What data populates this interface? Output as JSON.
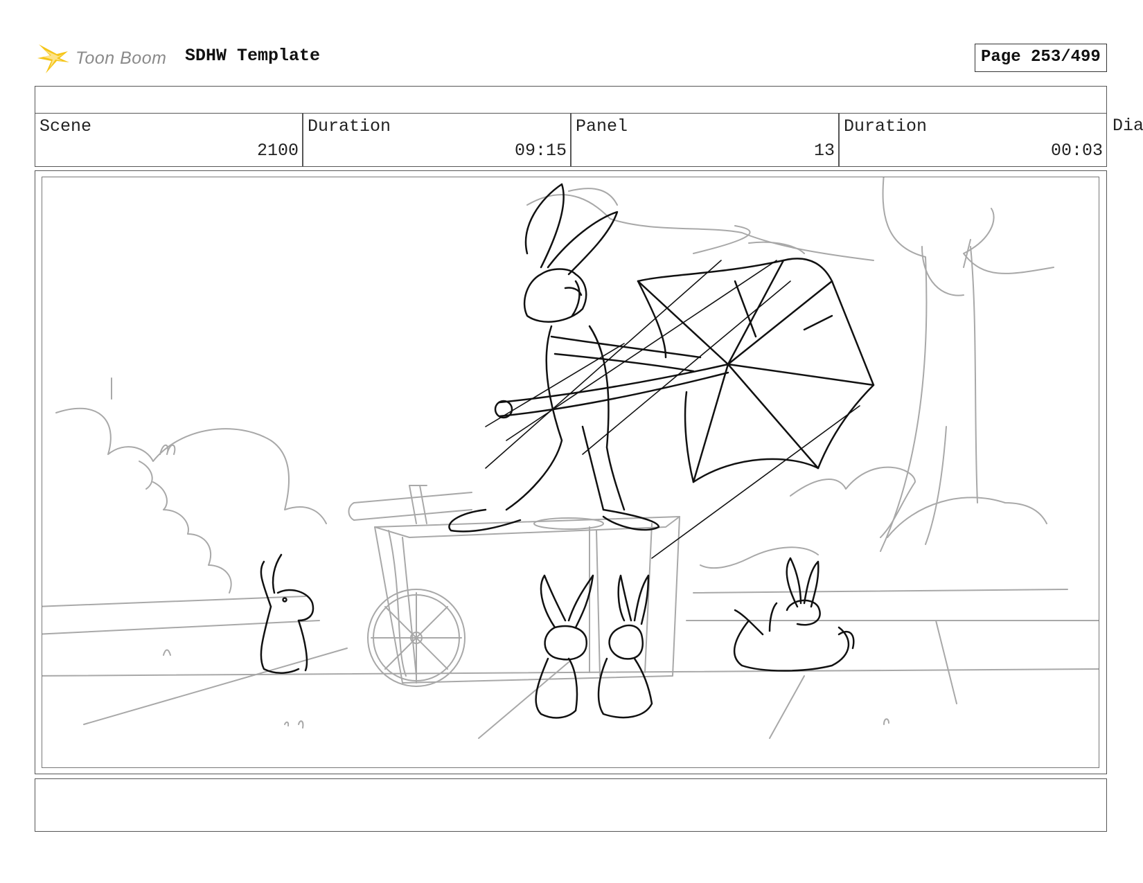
{
  "header": {
    "logo_text": "Toon Boom",
    "title": "SDHW Template",
    "page_label": "Page 253/499"
  },
  "info": {
    "scene": {
      "label": "Scene",
      "value": "2100"
    },
    "scene_duration": {
      "label": "Duration",
      "value": "09:15"
    },
    "panel": {
      "label": "Panel",
      "value": "13"
    },
    "panel_duration": {
      "label": "Duration",
      "value": "00:03"
    },
    "dialog_label_cut": "Dia"
  },
  "colors": {
    "logo_yellow": "#f5c518",
    "border": "#555555",
    "sketch_ink": "#111111",
    "sketch_background": "#a8a8a8"
  }
}
